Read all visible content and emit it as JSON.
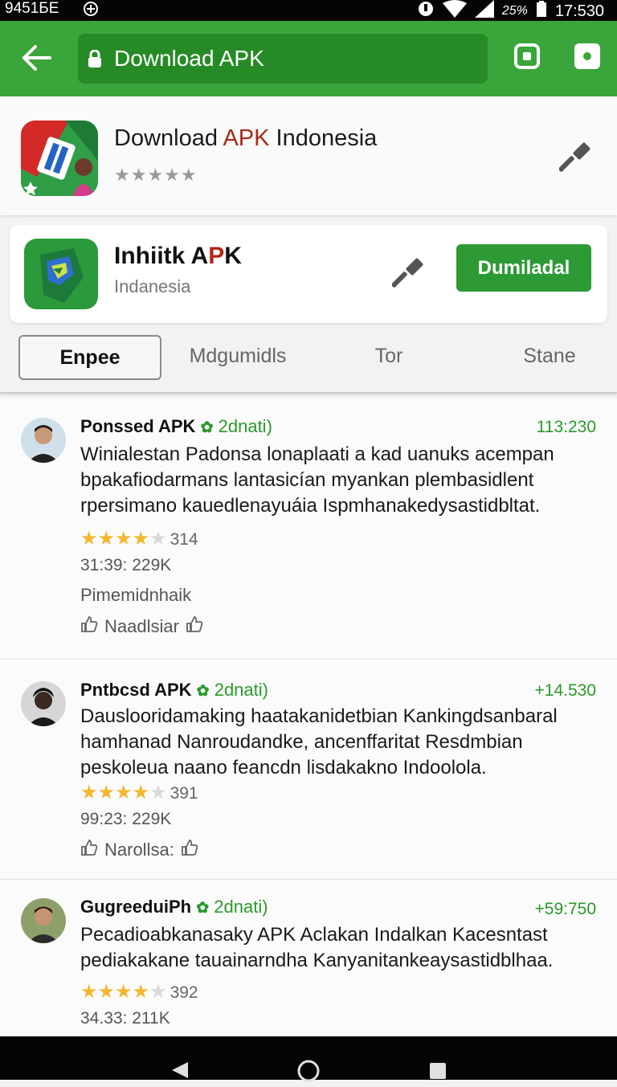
{
  "status_bar": {
    "left": "9451БЕ",
    "battery": "25%",
    "time": "17:530"
  },
  "browser": {
    "url": "Download APK"
  },
  "header": {
    "title_pre": "Download ",
    "title_hl": "APK",
    "title_post": " Indonesia",
    "stars": "★★★★★"
  },
  "app_card": {
    "title_pre": "Inhiitk A",
    "title_hl": "P",
    "title_post": "K",
    "subtitle": "Indanesia",
    "download_label": "Dumiladal"
  },
  "tabs": [
    "Enpee",
    "Mdgumidls",
    "Tor",
    "Stane"
  ],
  "reviews": [
    {
      "name": "Ponssed APK",
      "level": "2dnati)",
      "number": "113:230",
      "text": "Winialestan Padonsa lonaplaati a kad uanuks acempan bpakafiodarmans lantasicían myankan plembasidlent rpersimano kauedlenayuáia Ispmhanakedysastidbltat.",
      "rating": 4,
      "rating_count": "314",
      "meta": "31:39: 229K",
      "extra": "Pimemidnhaik",
      "action": "Naadlsiar"
    },
    {
      "name": "Pntbcsd APK",
      "level": "2dnati)",
      "number": "+14.530",
      "text": "Dauslooridamaking haatakanidetbian Kankingdsanbaral hamhanad Nanroudandke, ancenffaritat Resdmbian peskoleua naano feancdn lisdakakno Indoolola.",
      "rating": 4,
      "rating_count": "391",
      "meta": "99:23: 229K",
      "extra": "",
      "action": "Narollsa:"
    },
    {
      "name": "GugreeduiPh",
      "level": "2dnati)",
      "number": "+59:750",
      "text": "Pecadioabkanasaky APK Aclakan Indalkan Kacesntast pediakakane tauainarndha Kanyanitankeaysastidblhaa.",
      "rating": 4,
      "rating_count": "392",
      "meta": "34.33: 211K",
      "extra": "",
      "action": ""
    }
  ],
  "colors": {
    "brand_green": "#3aa53a",
    "url_green": "#268b26",
    "button_green": "#2e9a36",
    "accent_red": "#a72b16",
    "star": "#f3b72e"
  },
  "icons": [
    "back-arrow-icon",
    "lock-icon",
    "screenshot-icon",
    "camera-icon",
    "hammer-icon",
    "verified-icon",
    "thumbs-up-icon",
    "nav-back-icon",
    "nav-home-icon",
    "nav-recents-icon"
  ]
}
